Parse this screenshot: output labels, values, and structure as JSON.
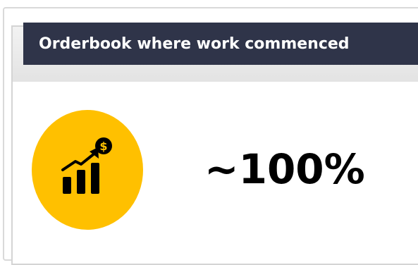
{
  "card": {
    "title": "Orderbook where work commenced",
    "icon": "revenue-growth-chart-icon",
    "value": "~100%"
  },
  "colors": {
    "title_bar": "#2f3449",
    "badge": "#ffc000",
    "text": "#000000"
  }
}
